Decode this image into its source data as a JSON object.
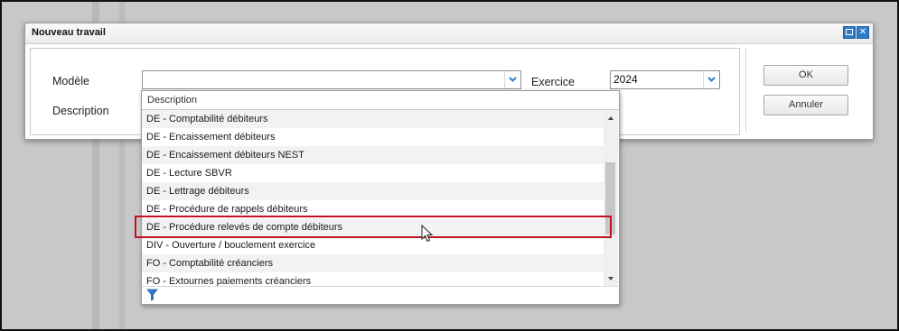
{
  "dialog": {
    "title": "Nouveau travail",
    "fields": {
      "modele_label": "Modèle",
      "modele_value": "",
      "exercice_label": "Exercice",
      "exercice_value": "2024",
      "description_label": "Description"
    },
    "buttons": {
      "ok": "OK",
      "cancel": "Annuler"
    }
  },
  "dropdown": {
    "header": "Description",
    "items": [
      "DE - Comptabilité débiteurs",
      "DE - Encaissement débiteurs",
      "DE - Encaissement débiteurs NEST",
      "DE - Lecture SBVR",
      "DE - Lettrage débiteurs",
      "DE - Procédure de rappels débiteurs",
      "DE - Procédure relevés de compte débiteurs",
      "DIV - Ouverture / bouclement exercice",
      "FO - Comptabilité créanciers",
      "FO - Extournes paiements créanciers"
    ],
    "highlighted_item": "DE - Procédure relevés de compte débiteurs"
  },
  "icons": {
    "max": "maximize-icon",
    "close": "close-icon",
    "filter": "filter-icon",
    "dropdown_arrow": "chevron-down-icon"
  },
  "colors": {
    "accent": "#2e7bc6",
    "highlight": "#c1121f"
  }
}
